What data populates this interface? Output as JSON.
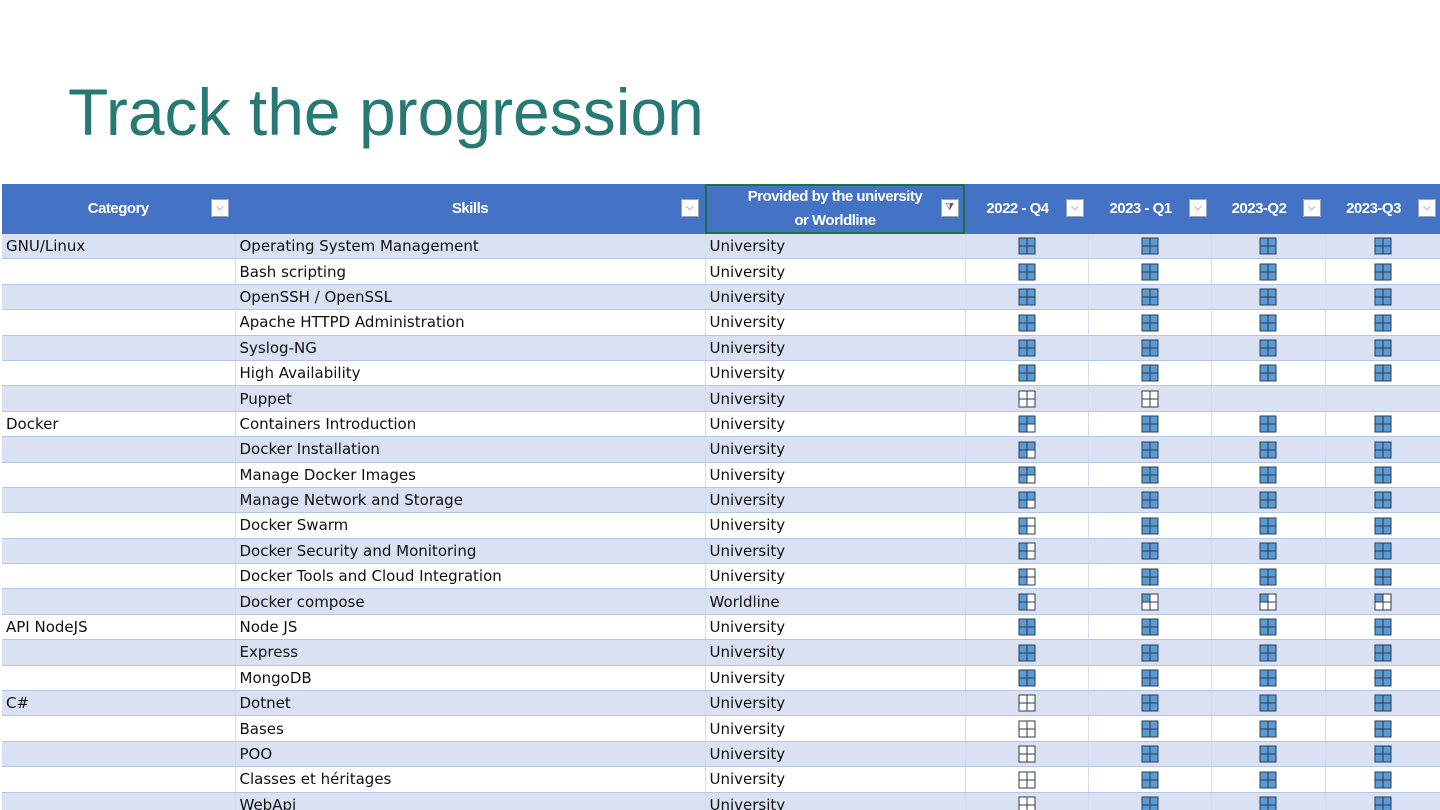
{
  "slide": {
    "title": "Track the progression"
  },
  "colors": {
    "accent_title": "#267a73",
    "header_bg": "#4472c4",
    "band_bg": "#d9e1f2",
    "checkbox_fill": "#5b9bd5"
  },
  "table": {
    "headers": {
      "category": "Category",
      "skills": "Skills",
      "provided_line1": "Provided by the university",
      "provided_line2": "or Worldline",
      "q1": "2022 - Q4",
      "q2": "2023 - Q1",
      "q3": "2023-Q2",
      "q4": "2023-Q3"
    },
    "filter_icons": {
      "dropdown": "filter-dropdown-icon",
      "filter_active": "filter-active-icon"
    },
    "rows": [
      {
        "category": "GNU/Linux",
        "skill": "Operating System Management",
        "provider": "University",
        "status": [
          "filled",
          "filled",
          "filled",
          "filled"
        ]
      },
      {
        "category": "",
        "skill": "Bash scripting",
        "provider": "University",
        "status": [
          "filled",
          "filled",
          "filled",
          "filled"
        ]
      },
      {
        "category": "",
        "skill": "OpenSSH / OpenSSL",
        "provider": "University",
        "status": [
          "filled",
          "filled",
          "filled",
          "filled"
        ]
      },
      {
        "category": "",
        "skill": "Apache HTTPD Administration",
        "provider": "University",
        "status": [
          "filled",
          "filled",
          "filled",
          "filled"
        ]
      },
      {
        "category": "",
        "skill": "Syslog-NG",
        "provider": "University",
        "status": [
          "filled",
          "filled",
          "filled",
          "filled"
        ]
      },
      {
        "category": "",
        "skill": "High Availability",
        "provider": "University",
        "status": [
          "filled",
          "filled",
          "filled",
          "filled"
        ]
      },
      {
        "category": "",
        "skill": "Puppet",
        "provider": "University",
        "status": [
          "empty",
          "empty",
          "none",
          "none"
        ]
      },
      {
        "category": "Docker",
        "skill": "Containers Introduction",
        "provider": "University",
        "status": [
          "partial3",
          "filled",
          "filled",
          "filled"
        ]
      },
      {
        "category": "",
        "skill": "Docker Installation",
        "provider": "University",
        "status": [
          "partial3",
          "filled",
          "filled",
          "filled"
        ]
      },
      {
        "category": "",
        "skill": "Manage Docker Images",
        "provider": "University",
        "status": [
          "partial3",
          "filled",
          "filled",
          "filled"
        ]
      },
      {
        "category": "",
        "skill": "Manage Network and Storage",
        "provider": "University",
        "status": [
          "partial3",
          "filled",
          "filled",
          "filled"
        ]
      },
      {
        "category": "",
        "skill": "Docker Swarm",
        "provider": "University",
        "status": [
          "partial2",
          "filled",
          "filled",
          "filled"
        ]
      },
      {
        "category": "",
        "skill": "Docker Security and Monitoring",
        "provider": "University",
        "status": [
          "partial2",
          "filled",
          "filled",
          "filled"
        ]
      },
      {
        "category": "",
        "skill": "Docker Tools and Cloud Integration",
        "provider": "University",
        "status": [
          "partial2",
          "filled",
          "filled",
          "filled"
        ]
      },
      {
        "category": "",
        "skill": "Docker compose",
        "provider": "Worldline",
        "status": [
          "partial2",
          "partial1",
          "partial1",
          "partial1"
        ]
      },
      {
        "category": "API NodeJS",
        "skill": "Node JS",
        "provider": "University",
        "status": [
          "filled",
          "filled",
          "filled",
          "filled"
        ]
      },
      {
        "category": "",
        "skill": "Express",
        "provider": "University",
        "status": [
          "filled",
          "filled",
          "filled",
          "filled"
        ]
      },
      {
        "category": "",
        "skill": "MongoDB",
        "provider": "University",
        "status": [
          "filled",
          "filled",
          "filled",
          "filled"
        ]
      },
      {
        "category": "C#",
        "skill": "Dotnet",
        "provider": "University",
        "status": [
          "empty",
          "filled",
          "filled",
          "filled"
        ]
      },
      {
        "category": "",
        "skill": "Bases",
        "provider": "University",
        "status": [
          "empty",
          "filled",
          "filled",
          "filled"
        ]
      },
      {
        "category": "",
        "skill": "POO",
        "provider": "University",
        "status": [
          "empty",
          "filled",
          "filled",
          "filled"
        ]
      },
      {
        "category": "",
        "skill": "Classes et héritages",
        "provider": "University",
        "status": [
          "empty",
          "filled",
          "filled",
          "filled"
        ]
      },
      {
        "category": "",
        "skill": "WebApi",
        "provider": "University",
        "status": [
          "empty",
          "filled",
          "filled",
          "filled"
        ]
      }
    ]
  }
}
